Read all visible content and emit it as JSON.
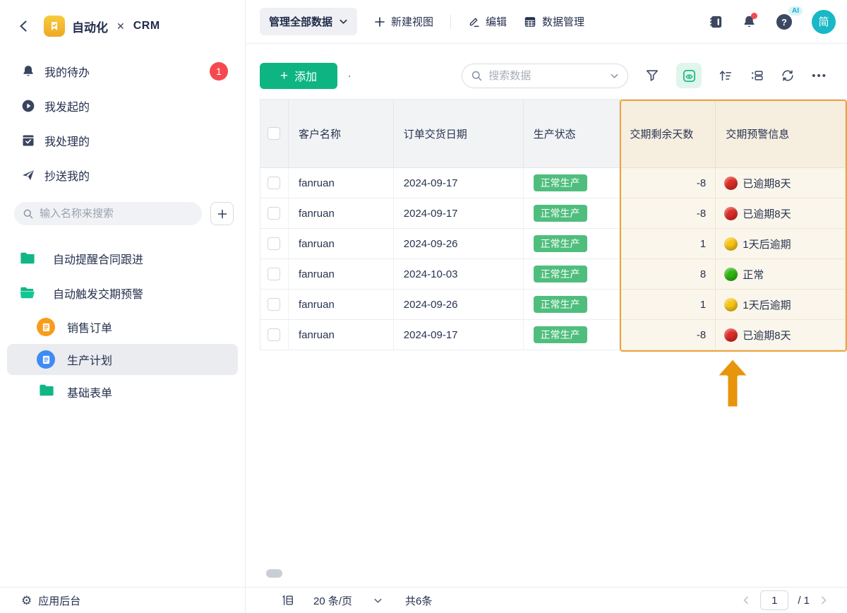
{
  "workspace": {
    "title": "自动化",
    "separator": "✕",
    "subtitle": "CRM"
  },
  "sidebar": {
    "items": [
      {
        "label": "我的待办",
        "badge": "1"
      },
      {
        "label": "我发起的"
      },
      {
        "label": "我处理的"
      },
      {
        "label": "抄送我的"
      }
    ],
    "search_placeholder": "输入名称来搜索",
    "folders": [
      {
        "label": "自动提醒合同跟进"
      },
      {
        "label": "自动触发交期预警"
      }
    ],
    "forms": [
      {
        "label": "销售订单",
        "icon_color": "#F89C1C"
      },
      {
        "label": "生产计划",
        "icon_color": "#3E8BF4"
      },
      {
        "label": "基础表单"
      }
    ],
    "footer_label": "应用后台"
  },
  "icons": {
    "gear": "⚙",
    "dot": "·",
    "more": "•••",
    "plus": "+"
  },
  "topnav": {
    "view_selector": "管理全部数据",
    "new_view": "新建视图",
    "edit": "编辑",
    "data_manage": "数据管理",
    "ai_badge": "AI",
    "avatar": "简"
  },
  "toolbar": {
    "add_label": "添加",
    "search_placeholder": "搜索数据"
  },
  "table": {
    "columns": [
      "客户名称",
      "订单交货日期",
      "生产状态",
      "交期剩余天数",
      "交期预警信息"
    ],
    "highlight_border_color": "#ECA43F",
    "status_badge_color": "#4FBE7D",
    "rows": [
      {
        "customer": "fanruan",
        "delivery_date": "2024-09-17",
        "status": "正常生产",
        "days_left": "-8",
        "warning": {
          "label": "已逾期8天",
          "color": "#DC2C26"
        }
      },
      {
        "customer": "fanruan",
        "delivery_date": "2024-09-17",
        "status": "正常生产",
        "days_left": "-8",
        "warning": {
          "label": "已逾期8天",
          "color": "#DC2C26"
        }
      },
      {
        "customer": "fanruan",
        "delivery_date": "2024-09-26",
        "status": "正常生产",
        "days_left": "1",
        "warning": {
          "label": "1天后逾期",
          "color": "#F7C515"
        }
      },
      {
        "customer": "fanruan",
        "delivery_date": "2024-10-03",
        "status": "正常生产",
        "days_left": "8",
        "warning": {
          "label": "正常",
          "color": "#2FB413"
        }
      },
      {
        "customer": "fanruan",
        "delivery_date": "2024-09-26",
        "status": "正常生产",
        "days_left": "1",
        "warning": {
          "label": "1天后逾期",
          "color": "#F7C515"
        }
      },
      {
        "customer": "fanruan",
        "delivery_date": "2024-09-17",
        "status": "正常生产",
        "days_left": "-8",
        "warning": {
          "label": "已逾期8天",
          "color": "#DC2C26"
        }
      }
    ]
  },
  "pagination": {
    "page_size": "20 条/页",
    "total": "共6条",
    "current_page": "1",
    "page_total": "/ 1"
  }
}
